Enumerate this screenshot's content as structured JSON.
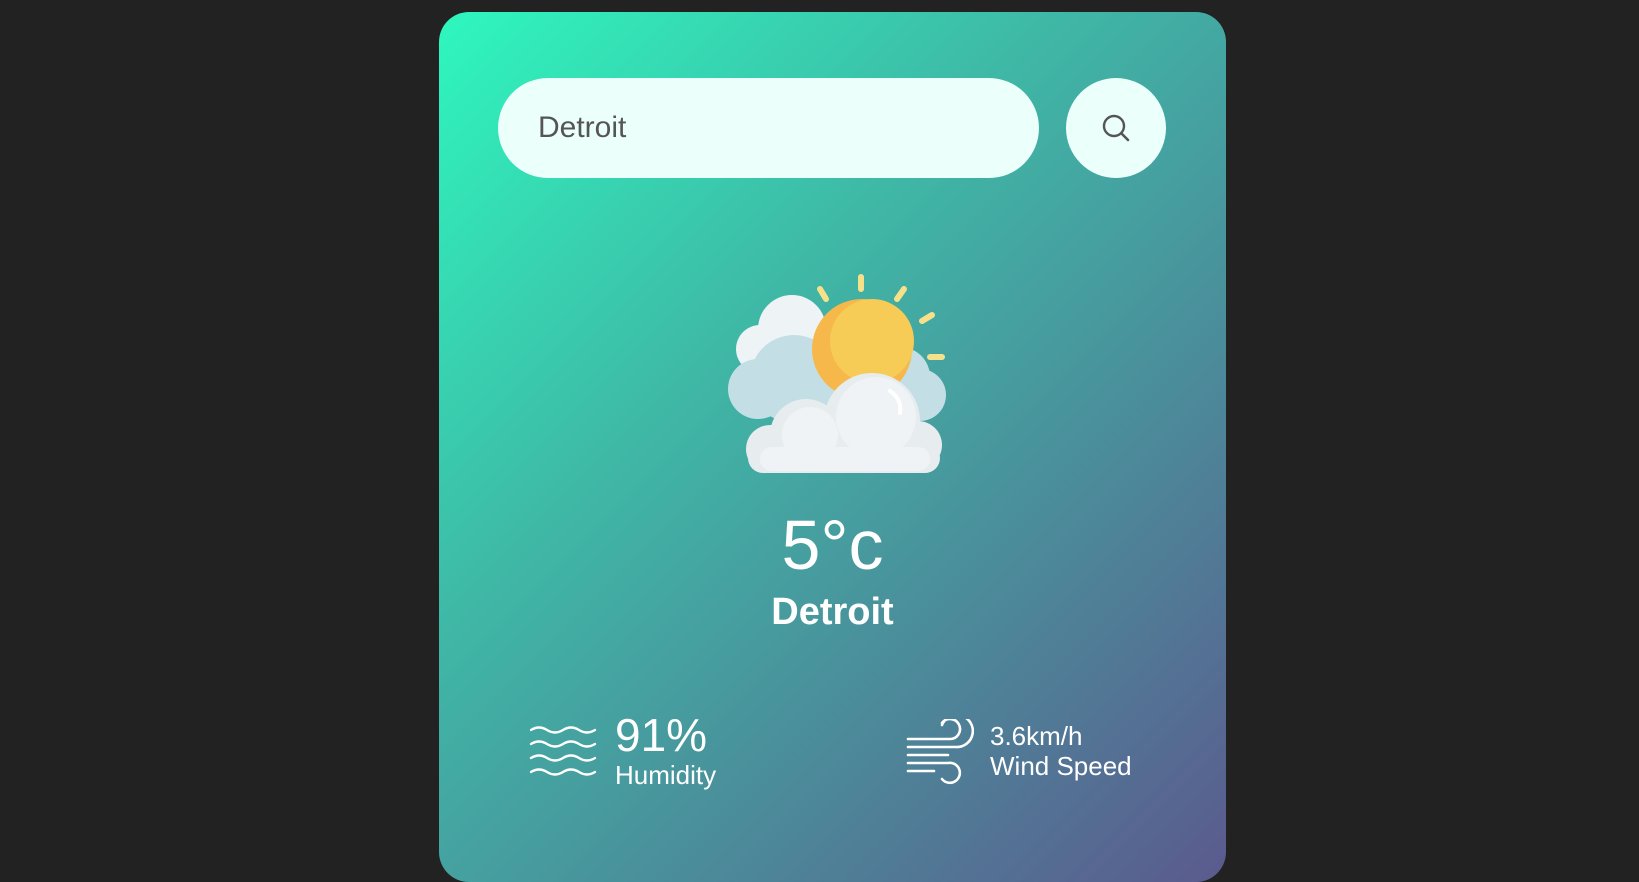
{
  "search": {
    "value": "Detroit",
    "placeholder": "Enter city name"
  },
  "weather": {
    "condition_icon": "partly-cloudy-sun-icon",
    "temperature": "5°c",
    "city": "Detroit"
  },
  "humidity": {
    "icon": "humidity-waves-icon",
    "value": "91%",
    "label": "Humidity"
  },
  "wind": {
    "icon": "wind-icon",
    "value": "3.6km/h",
    "label": "Wind Speed"
  },
  "colors": {
    "background": "#222222",
    "card_gradient_start": "#2ef7be",
    "card_gradient_end": "#5b5a8e",
    "input_background": "#ebfffb",
    "text_light": "#ffffff"
  }
}
